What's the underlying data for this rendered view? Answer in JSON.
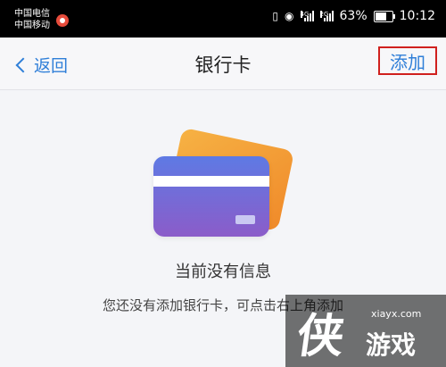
{
  "status_bar": {
    "carrier1": "中国电信",
    "carrier2": "中国移动",
    "net1": "4G",
    "net2": "2G",
    "battery": "63%",
    "time": "10:12"
  },
  "nav": {
    "back_label": "返回",
    "title": "银行卡",
    "add_label": "添加"
  },
  "empty_state": {
    "title": "当前没有信息",
    "description": "您还没有添加银行卡，可点击右上角添加"
  },
  "watermark": {
    "glyph": "侠",
    "url": "xiayx.com",
    "text": "游戏"
  },
  "colors": {
    "accent": "#2f7fd8",
    "highlight_border": "#d0201e"
  }
}
